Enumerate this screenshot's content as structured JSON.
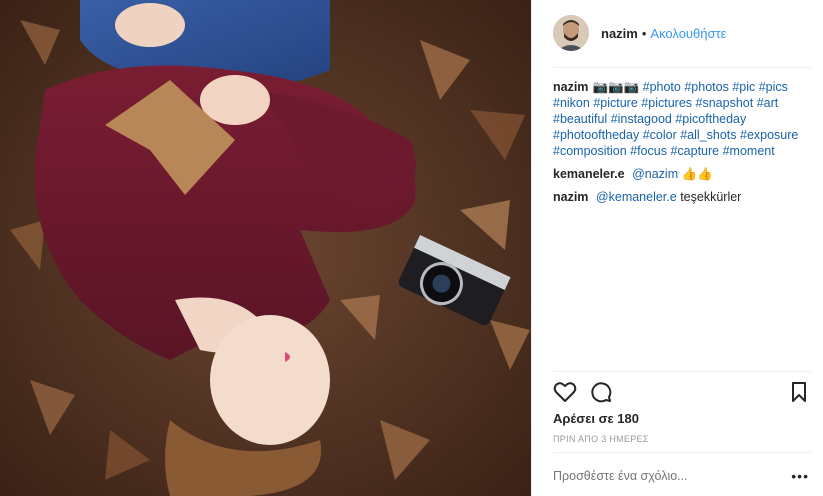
{
  "post": {
    "photo_alt": "woman lying on autumn leaves with camera"
  },
  "header": {
    "username": "nazim",
    "separator": "•",
    "follow_label": "Ακολουθήστε"
  },
  "caption": {
    "username": "nazim",
    "emojis": "📷📷📷",
    "hashtags": [
      "#photo",
      "#photos",
      "#pic",
      "#pics",
      "#nikon",
      "#picture",
      "#pictures",
      "#snapshot",
      "#art",
      "#beautiful",
      "#instagood",
      "#picoftheday",
      "#photooftheday",
      "#color",
      "#all_shots",
      "#exposure",
      "#composition",
      "#focus",
      "#capture",
      "#moment"
    ]
  },
  "comments": [
    {
      "username": "kemaneler.e",
      "mention": "@nazim",
      "text": "👍👍"
    },
    {
      "username": "nazim",
      "mention": "@kemaneler.e",
      "text": "teşekkürler"
    }
  ],
  "likes": {
    "label": "Αρέσει σε 180"
  },
  "timestamp": "ΠΡΙΝ ΑΠΟ 3 ΗΜΕΡΕΣ",
  "add_comment": {
    "placeholder": "Προσθέστε ένα σχόλιο..."
  },
  "more_label": "•••"
}
